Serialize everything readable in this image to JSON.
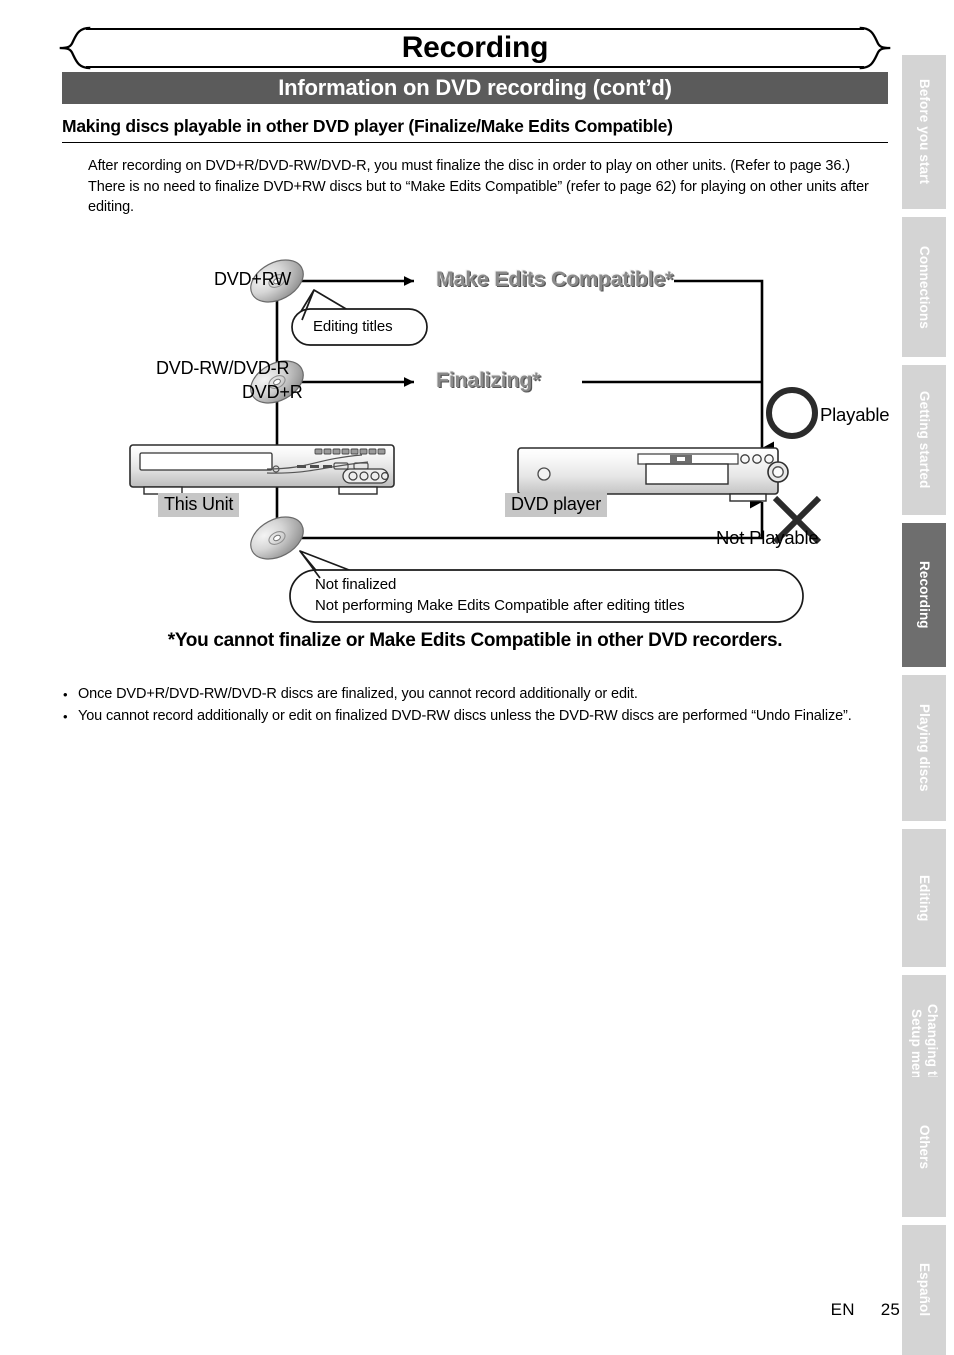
{
  "chapter": {
    "title": "Recording"
  },
  "section": {
    "title": "Information on DVD recording (cont’d)"
  },
  "subheading": {
    "text": "Making discs playable in other DVD player (Finalize/Make Edits Compatible)"
  },
  "intro": {
    "paragraph1": "After recording on DVD+R/DVD-RW/DVD-R, you must finalize the disc in order to play on other units. (Refer to page 36.)",
    "paragraph2": "There is no need to finalize DVD+RW discs but to “Make Edits Compatible” (refer to page 62) for playing on other units after editing."
  },
  "diagram": {
    "disc_label_1": "DVD+RW",
    "disc_label_2_line1": "DVD-RW/DVD-R",
    "disc_label_2_line2": "DVD+R",
    "flow_make_edits": "Make Edits Compatible*",
    "flow_finalizing": "Finalizing*",
    "callout_editing_titles": "Editing titles",
    "callout_not_finalized_line1": "Not finalized",
    "callout_not_finalized_line2": "Not performing Make Edits Compatible after editing titles",
    "device_this_unit": "This Unit",
    "device_dvd_player": "DVD player",
    "verdict_playable": "Playable",
    "verdict_not_playable": "Not Playable"
  },
  "note": {
    "star_text": "*You cannot finalize or Make Edits Compatible in other DVD recorders."
  },
  "bullets": [
    "Once DVD+R/DVD-RW/DVD-R discs are finalized, you cannot record additionally or edit.",
    "You cannot record additionally or edit on finalized DVD-RW discs unless the DVD-RW discs are performed “Undo Finalize”."
  ],
  "tabs": [
    {
      "label": "Before you start",
      "active": false
    },
    {
      "label": "Connections",
      "active": false
    },
    {
      "label": "Getting started",
      "active": false
    },
    {
      "label": "Recording",
      "active": true
    },
    {
      "label": "Playing discs",
      "active": false
    },
    {
      "label": "Editing",
      "active": false
    },
    {
      "label": "Changing the\nSetup menu",
      "active": false
    },
    {
      "label": "Others",
      "active": false
    },
    {
      "label": "Español",
      "active": false
    }
  ],
  "footer": {
    "language_code": "EN",
    "page_number": "25"
  },
  "colors": {
    "section_bar": "#5b5b5b",
    "tab_inactive": "#d4d4d4",
    "tab_active": "#6e6e6e",
    "highlight": "#c6c6c6",
    "flow_text": "#8a8a8a"
  }
}
